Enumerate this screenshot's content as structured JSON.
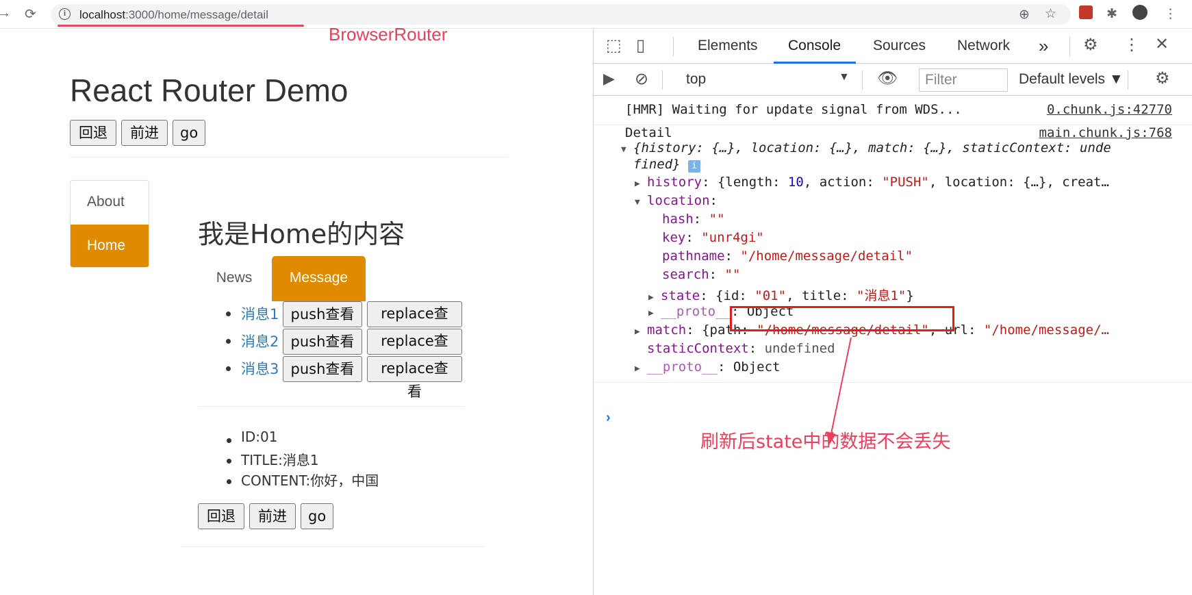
{
  "browser": {
    "url_host": "localhost",
    "url_path": ":3000/home/message/detail",
    "annotation": "BrowserRouter"
  },
  "app": {
    "title": "React Router Demo",
    "top_buttons": [
      "回退",
      "前进",
      "go"
    ],
    "sidebar": [
      {
        "label": "About",
        "active": false
      },
      {
        "label": "Home",
        "active": true
      }
    ],
    "home_title": "我是Home的内容",
    "tabs": [
      {
        "label": "News",
        "active": false
      },
      {
        "label": "Message",
        "active": true
      }
    ],
    "messages": [
      {
        "link": "消息1",
        "push": "push查看",
        "replace": "replace查看"
      },
      {
        "link": "消息2",
        "push": "push查看",
        "replace": "replace查看"
      },
      {
        "link": "消息3",
        "push": "push查看",
        "replace": "replace查看"
      }
    ],
    "details": [
      "ID:01",
      "TITLE:消息1",
      "CONTENT:你好，中国"
    ],
    "bottom_buttons": [
      "回退",
      "前进",
      "go"
    ]
  },
  "devtools": {
    "tabs": [
      "Elements",
      "Console",
      "Sources",
      "Network",
      "»"
    ],
    "active_tab": "Console",
    "context": "top",
    "filter_placeholder": "Filter",
    "levels": "Default levels ▼",
    "console": {
      "hmr": "[HMR] Waiting for update signal from WDS...",
      "hmr_src": "0.chunk.js:42770",
      "detail": "Detail",
      "detail_src": "main.chunk.js:768",
      "summary_1": "{history: {…}, location: {…}, match: {…}, staticContext: unde",
      "summary_2": "fined}",
      "history_key": "history",
      "history_val_a": "{length: ",
      "history_len": "10",
      "history_val_b": ", action: ",
      "history_action": "\"PUSH\"",
      "history_val_c": ", location: {…}, creat…",
      "location_key": "location",
      "hash_key": "hash",
      "hash_val": "\"\"",
      "key_key": "key",
      "key_val": "\"unr4gi\"",
      "pathname_key": "pathname",
      "pathname_val": "\"/home/message/detail\"",
      "search_key": "search",
      "search_val": "\"\"",
      "state_key": "state",
      "state_a": "{id: ",
      "state_id": "\"01\"",
      "state_b": ", title: ",
      "state_title": "\"消息1\"",
      "state_c": "}",
      "proto_key": "__proto__",
      "proto_val": "Object",
      "match_key": "match",
      "match_a": "{path: ",
      "match_path": "\"/home/message/detail\"",
      "match_b": ", url: ",
      "match_url": "\"/home/message/…",
      "static_key": "staticContext",
      "static_val": "undefined",
      "proto2_key": "__proto__",
      "proto2_val": "Object"
    },
    "annotation": "刷新后state中的数据不会丢失"
  }
}
